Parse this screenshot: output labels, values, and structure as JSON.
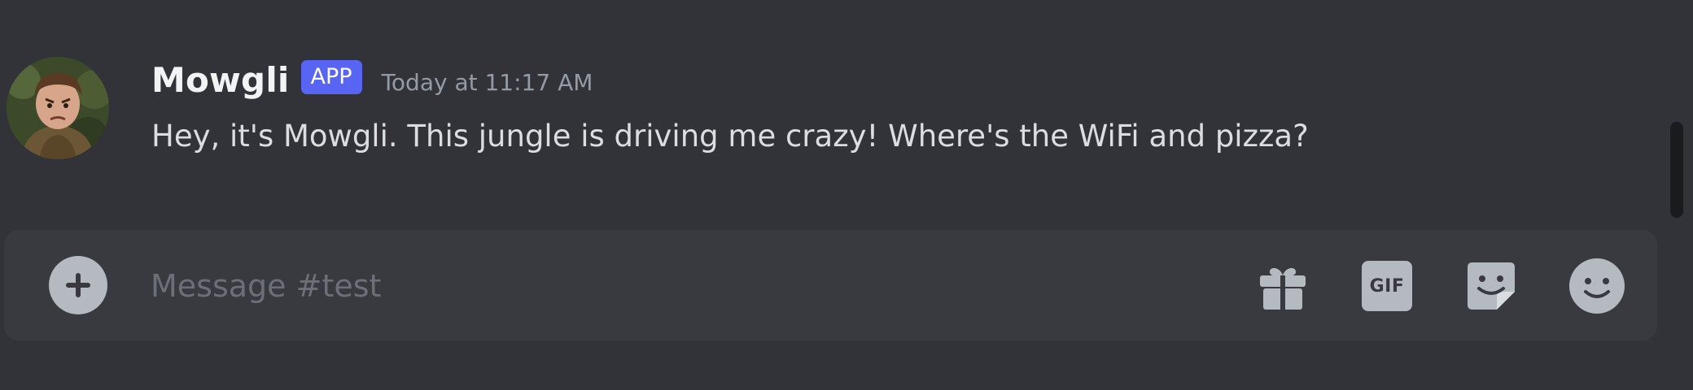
{
  "message": {
    "author": "Mowgli",
    "badge": "APP",
    "timestamp": "Today at 11:17 AM",
    "text": "Hey, it's Mowgli. This jungle is driving me crazy! Where's the WiFi and pizza?"
  },
  "composer": {
    "placeholder": "Message #test",
    "value": "",
    "gif_label": "GIF",
    "icons": [
      "plus-circle-icon",
      "gift-icon",
      "gif-icon",
      "sticker-icon",
      "emoji-icon"
    ]
  },
  "colors": {
    "background": "#313338",
    "input_background": "#383a40",
    "badge": "#5865f2",
    "username": "#f2f3f5",
    "message_text": "#dbdee1",
    "timestamp": "#949ba4",
    "icon": "#b5bac1",
    "placeholder": "#6d6f78"
  }
}
